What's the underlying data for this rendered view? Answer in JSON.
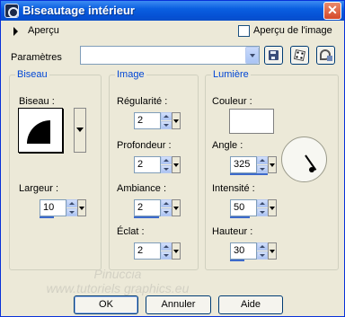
{
  "window": {
    "title": "Biseautage intérieur",
    "close_glyph": "✕"
  },
  "preview": {
    "label": "Aperçu",
    "checkbox_label": "Aperçu de l'image",
    "checkbox_checked": false
  },
  "parameters": {
    "label": "Paramètres",
    "selected_value": ""
  },
  "bevel_group": {
    "title": "Biseau",
    "bevel_label": "Biseau :",
    "width_label": "Largeur :",
    "width_value": "10"
  },
  "image_group": {
    "title": "Image",
    "smoothness_label": "Régularité :",
    "smoothness_value": "2",
    "depth_label": "Profondeur :",
    "depth_value": "2",
    "ambience_label": "Ambiance :",
    "ambience_value": "2",
    "shininess_label": "Éclat :",
    "shininess_value": "2"
  },
  "light_group": {
    "title": "Lumière",
    "color_label": "Couleur :",
    "color_value": "#ffffff",
    "angle_label": "Angle :",
    "angle_value": "325",
    "intensity_label": "Intensité :",
    "intensity_value": "50",
    "elevation_label": "Hauteur :",
    "elevation_value": "30"
  },
  "buttons": {
    "ok": "OK",
    "cancel": "Annuler",
    "help": "Aide"
  },
  "watermark": {
    "line1": "Pinuccia",
    "line2": "www.tutoriels graphics.eu"
  }
}
